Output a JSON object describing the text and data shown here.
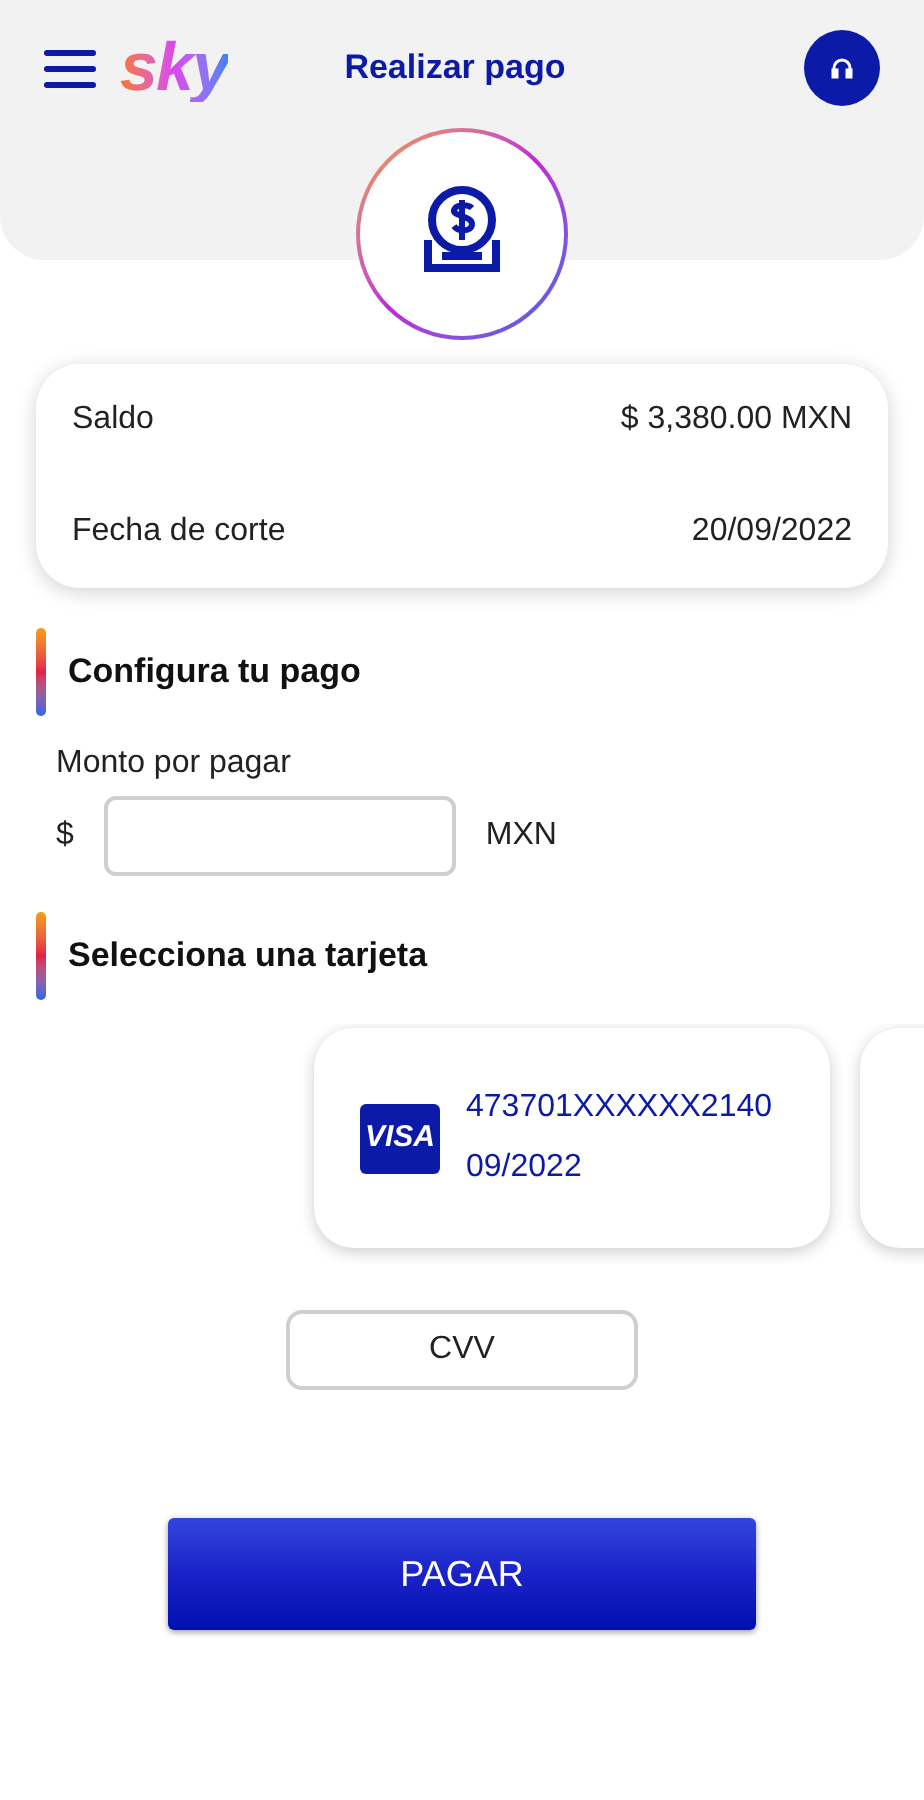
{
  "header": {
    "logo": "sky",
    "title": "Realizar pago"
  },
  "summary": [
    {
      "label": "Saldo",
      "value": "$ 3,380.00 MXN"
    },
    {
      "label": "Fecha de corte",
      "value": "20/09/2022"
    }
  ],
  "payment": {
    "heading": "Configura tu pago",
    "amount_label": "Monto por pagar",
    "currency_symbol": "$",
    "currency": "MXN"
  },
  "cards": {
    "heading": "Selecciona una tarjeta",
    "items": [
      {
        "kind": "card",
        "brand": "VISA",
        "number": "473701XXXXXX2140",
        "expiry": "09/2022"
      },
      {
        "kind": "partial"
      }
    ]
  },
  "cvv": {
    "placeholder": "CVV"
  },
  "pay_button": "PAGAR"
}
